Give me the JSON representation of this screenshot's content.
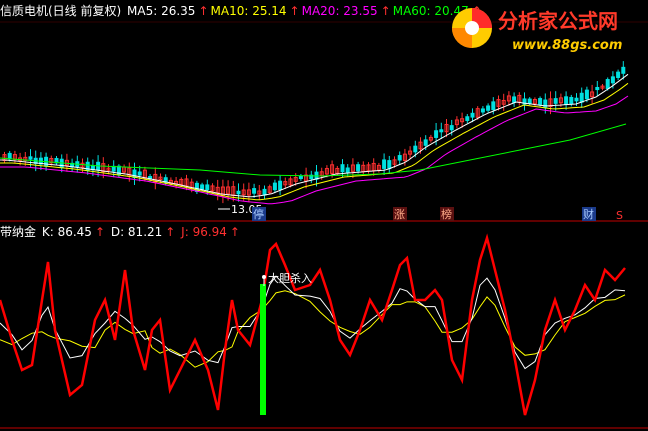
{
  "header": {
    "stock": "信质电机(日线 前复权)",
    "ma": [
      {
        "label": "MA5: 26.35",
        "color": "#ffffff"
      },
      {
        "label": "MA10: 25.14",
        "color": "#ffff00"
      },
      {
        "label": "MA20: 23.55",
        "color": "#ff00ff"
      },
      {
        "label": "MA60: 20.47",
        "color": "#00ff00"
      }
    ],
    "arrow": "↑"
  },
  "kdj_header": {
    "name": "带纳金",
    "k": "K: 86.45",
    "d": "D: 81.21",
    "j": "J: 96.94"
  },
  "logo": {
    "text": "分析家公式网",
    "url": "www.88gs.com"
  },
  "annotations": {
    "low_price": "13.05",
    "signal": "大胆杀入"
  },
  "badges": [
    {
      "text": "停",
      "kind": "blue"
    },
    {
      "text": "涨",
      "kind": "red"
    },
    {
      "text": "榜",
      "kind": "red"
    },
    {
      "text": "财",
      "kind": "blue"
    },
    {
      "text": "S",
      "kind": "text"
    }
  ],
  "colors": {
    "up": "#ff3030",
    "down": "#00e0e0",
    "ma5": "#ffffff",
    "ma10": "#ffff00",
    "ma20": "#ff00ff",
    "ma60": "#00ff00",
    "k": "#ffffff",
    "d": "#ffff00",
    "j": "#ff0000",
    "signal_bar": "#00ff00",
    "panel_border": "#c00000"
  }
}
